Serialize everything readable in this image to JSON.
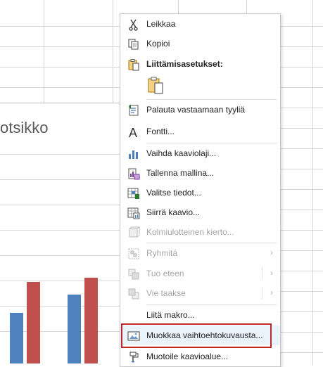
{
  "chart": {
    "title": "otsikko",
    "bars": [
      {
        "series": "blue",
        "value": 0.9
      },
      {
        "series": "red",
        "value": 1.45
      },
      {
        "series": "blue",
        "value": 1.22
      },
      {
        "series": "red",
        "value": 1.52
      }
    ],
    "colors": {
      "blue": "#4f81bd",
      "red": "#c0504d"
    }
  },
  "menu": {
    "items": [
      {
        "label": "Leikkaa",
        "icon": "scissors-icon",
        "enabled": true
      },
      {
        "label": "Kopioi",
        "icon": "copy-icon",
        "enabled": true
      },
      {
        "label": "Liittämisasetukset:",
        "icon": "paste-options-icon",
        "enabled": true,
        "bold": true
      },
      {
        "label": "",
        "icon": "paste-keep-formatting-icon",
        "enabled": true
      },
      {
        "label": "Palauta vastaamaan tyyliä",
        "icon": "reset-style-icon",
        "enabled": true
      },
      {
        "label": "Fontti...",
        "icon": "font-icon",
        "enabled": true
      },
      {
        "label": "Vaihda kaaviolaji...",
        "icon": "change-chart-type-icon",
        "enabled": true
      },
      {
        "label": "Tallenna mallina...",
        "icon": "save-as-template-icon",
        "enabled": true
      },
      {
        "label": "Valitse tiedot...",
        "icon": "select-data-icon",
        "enabled": true
      },
      {
        "label": "Siirrä kaavio...",
        "icon": "move-chart-icon",
        "enabled": true
      },
      {
        "label": "Kolmiulotteinen kierto...",
        "icon": "3d-rotation-icon",
        "enabled": false
      },
      {
        "label": "Ryhmitä",
        "icon": "group-icon",
        "enabled": false,
        "submenu": true
      },
      {
        "label": "Tuo eteen",
        "icon": "bring-forward-icon",
        "enabled": false,
        "submenu": true
      },
      {
        "label": "Vie taakse",
        "icon": "send-backward-icon",
        "enabled": false,
        "submenu": true
      },
      {
        "label": "Liitä makro...",
        "icon": "",
        "enabled": true
      },
      {
        "label": "Muokkaa vaihtoehtokuvausta...",
        "icon": "alt-text-icon",
        "enabled": true,
        "highlighted": true
      },
      {
        "label": "Muotoile kaavioalue...",
        "icon": "format-chart-area-icon",
        "enabled": true
      }
    ],
    "submenu_arrow": "›"
  }
}
